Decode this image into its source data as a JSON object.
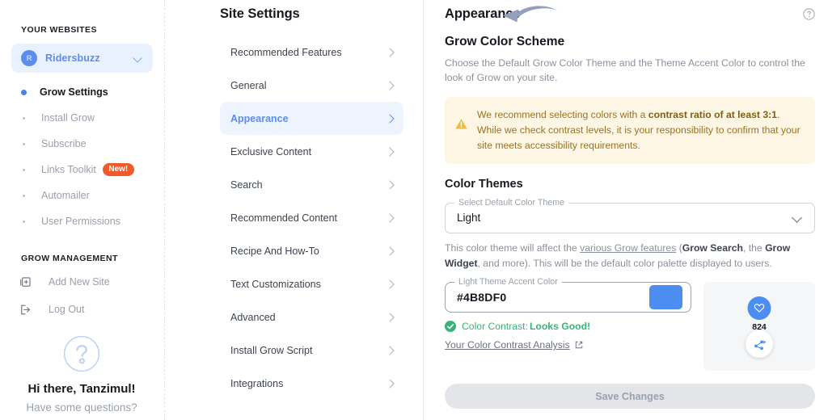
{
  "sidebar": {
    "websites_label": "YOUR WEBSITES",
    "site": {
      "initial": "R",
      "name": "Ridersbuzz",
      "chevron_icon": "chevron-down-icon"
    },
    "nav": [
      {
        "label": "Grow Settings",
        "active": true
      },
      {
        "label": "Install Grow",
        "active": false
      },
      {
        "label": "Subscribe",
        "active": false
      },
      {
        "label": "Links Toolkit",
        "active": false,
        "badge": "New!"
      },
      {
        "label": "Automailer",
        "active": false
      },
      {
        "label": "User Permissions",
        "active": false
      }
    ],
    "management_label": "GROW MANAGEMENT",
    "management": [
      {
        "label": "Add New Site",
        "icon": "add-site-icon"
      },
      {
        "label": "Log Out",
        "icon": "logout-icon"
      }
    ],
    "help": {
      "icon": "question-mark-circle-icon",
      "greeting": "Hi there, Tanzimul!",
      "subtitle": "Have some questions?"
    }
  },
  "settings": {
    "title": "Site Settings",
    "items": [
      {
        "label": "Recommended Features",
        "active": false
      },
      {
        "label": "General",
        "active": false
      },
      {
        "label": "Appearance",
        "active": true
      },
      {
        "label": "Exclusive Content",
        "active": false
      },
      {
        "label": "Search",
        "active": false
      },
      {
        "label": "Recommended Content",
        "active": false
      },
      {
        "label": "Recipe And How-To",
        "active": false
      },
      {
        "label": "Text Customizations",
        "active": false
      },
      {
        "label": "Advanced",
        "active": false
      },
      {
        "label": "Install Grow Script",
        "active": false
      },
      {
        "label": "Integrations",
        "active": false
      }
    ]
  },
  "main": {
    "page_title": "Appearance",
    "help_icon": "question-mark-circle-icon",
    "annotation_icon": "curved-left-arrow-icon",
    "section_heading": "Grow Color Scheme",
    "section_description": "Choose the Default Grow Color Theme and the Theme Accent Color to control the look of Grow on your site.",
    "warning": {
      "icon": "warning-triangle-icon",
      "text_part1": "We recommend selecting colors with a ",
      "text_bold": "contrast ratio of at least 3:1",
      "text_part2": ". While we check contrast levels, it is your responsibility to confirm that your site meets accessibility requirements."
    },
    "color_themes_heading": "Color Themes",
    "theme_select": {
      "legend": "Select Default Color Theme",
      "value": "Light",
      "chevron_icon": "chevron-down-icon"
    },
    "theme_help": {
      "part1": "This color theme will affect the ",
      "link": "various Grow features",
      "part2": " (",
      "bold1": "Grow Search",
      "part3": ", the ",
      "bold2": "Grow Widget",
      "part4": ", and more). This will be the default color palette displayed to users."
    },
    "accent": {
      "legend": "Light Theme Accent Color",
      "value": "#4B8DF0",
      "swatch_color": "#4B8DF0",
      "swatch_icon": "color-swatch"
    },
    "contrast": {
      "check_icon": "check-circle-icon",
      "label": "Color Contrast: ",
      "status": "Looks Good!",
      "status_color": "#3AB37A",
      "analysis_link": "Your Color Contrast Analysis",
      "external_icon": "external-link-icon"
    },
    "preview": {
      "heart_icon": "heart-icon",
      "count": "824",
      "share_icon": "share-icon",
      "accent_color": "#4B8DF0"
    },
    "save_label": "Save Changes"
  }
}
